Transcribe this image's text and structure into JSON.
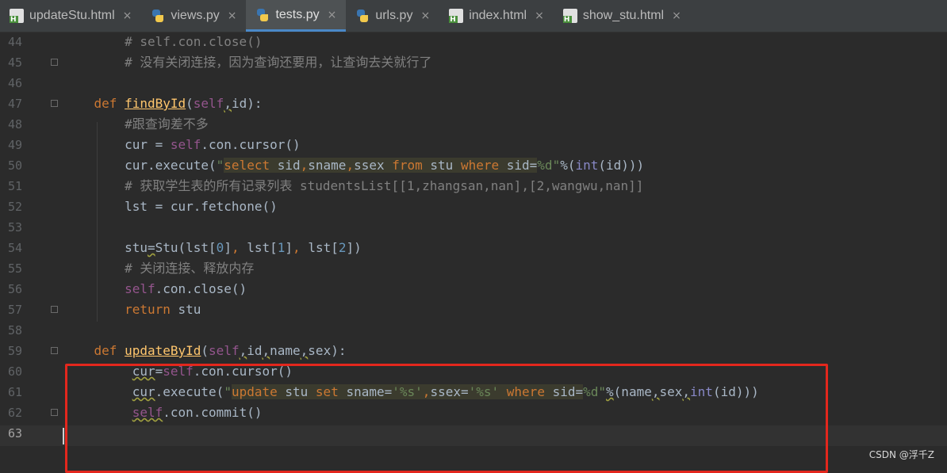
{
  "tabs": [
    {
      "label": "updateStu.html",
      "icon": "html-file-icon",
      "close": "×"
    },
    {
      "label": "views.py",
      "icon": "python-file-icon",
      "close": "×"
    },
    {
      "label": "tests.py",
      "icon": "python-file-icon",
      "close": "×",
      "active": true
    },
    {
      "label": "urls.py",
      "icon": "python-file-icon",
      "close": "×"
    },
    {
      "label": "index.html",
      "icon": "html-file-icon",
      "close": "×"
    },
    {
      "label": "show_stu.html",
      "icon": "html-file-icon",
      "close": "×"
    }
  ],
  "lines": [
    {
      "num": "44",
      "text": "        # self.con.close()"
    },
    {
      "num": "45",
      "text": "        # 没有关闭连接，因为查询还要用，让查询去关就行了"
    },
    {
      "num": "46",
      "text": ""
    },
    {
      "num": "47",
      "text": "    def findById(self,id):"
    },
    {
      "num": "48",
      "text": "        #跟查询差不多"
    },
    {
      "num": "49",
      "text": "        cur = self.con.cursor()"
    },
    {
      "num": "50",
      "text": "        cur.execute(\"select sid,sname,ssex from stu where sid=%d\"%(int(id)))"
    },
    {
      "num": "51",
      "text": "        # 获取学生表的所有记录列表 studentsList[[1,zhangsan,nan],[2,wangwu,nan]]"
    },
    {
      "num": "52",
      "text": "        lst = cur.fetchone()"
    },
    {
      "num": "53",
      "text": ""
    },
    {
      "num": "54",
      "text": "        stu=Stu(lst[0], lst[1], lst[2])"
    },
    {
      "num": "55",
      "text": "        # 关闭连接、释放内存"
    },
    {
      "num": "56",
      "text": "        self.con.close()"
    },
    {
      "num": "57",
      "text": "        return stu"
    },
    {
      "num": "58",
      "text": ""
    },
    {
      "num": "59",
      "text": "    def updateById(self,id,name,sex):"
    },
    {
      "num": "60",
      "text": "         cur=self.con.cursor()"
    },
    {
      "num": "61",
      "text": "         cur.execute(\"update stu set sname='%s',ssex='%s' where sid=%d\"%(name,sex,int(id)))"
    },
    {
      "num": "62",
      "text": "         self.con.commit()"
    },
    {
      "num": "63",
      "text": ""
    }
  ],
  "watermark": "CSDN @浮千Z",
  "colors": {
    "highlight_box": "#e3271d",
    "background": "#2b2b2b",
    "keyword": "#cc7832",
    "string": "#6a8759"
  }
}
